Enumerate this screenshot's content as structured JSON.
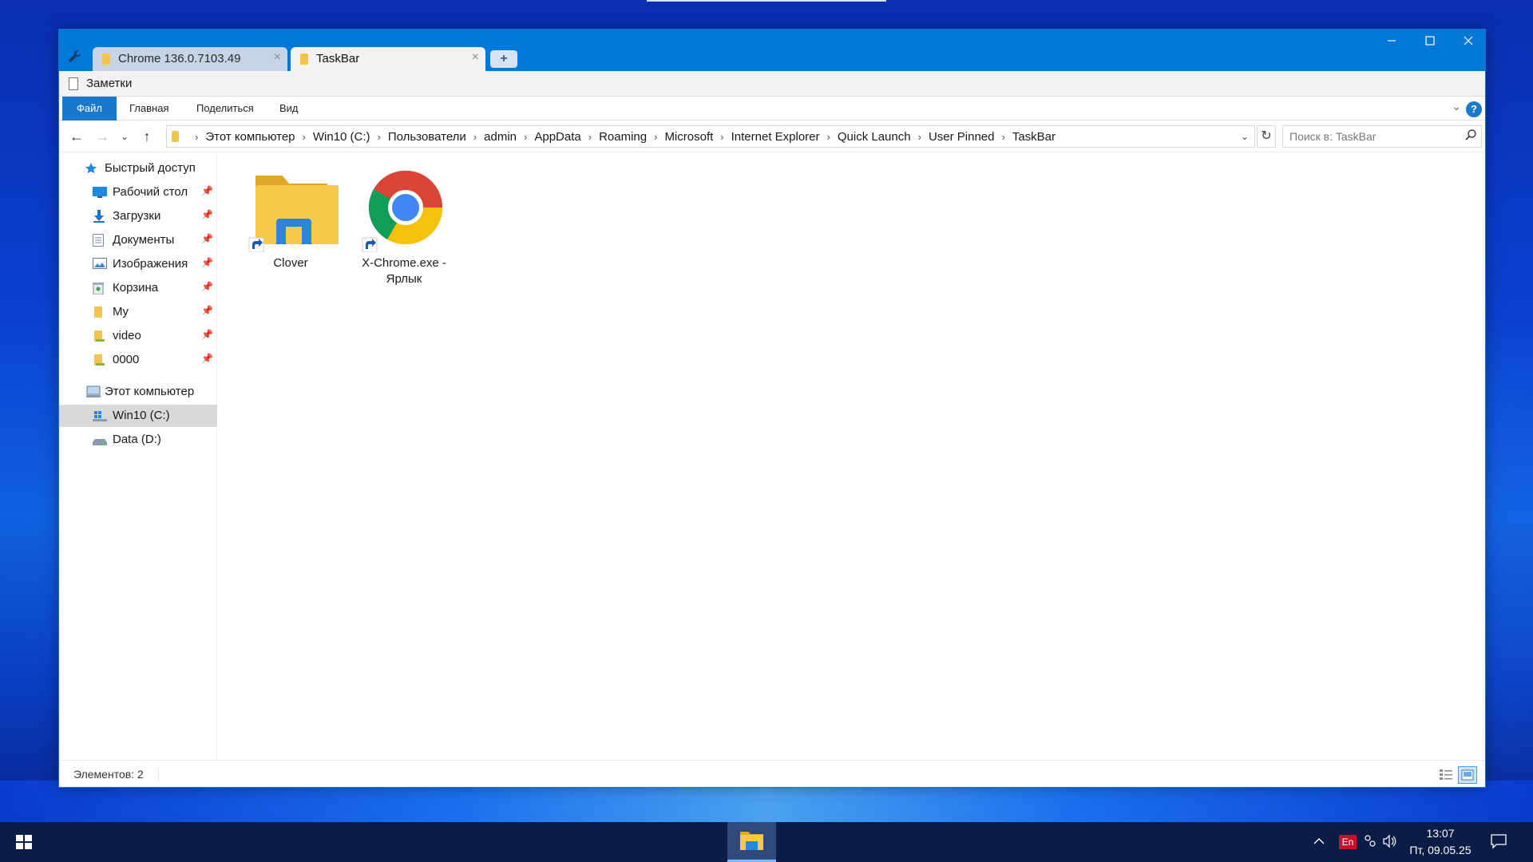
{
  "tabs": [
    {
      "label": "Chrome 136.0.7103.49",
      "active": false
    },
    {
      "label": "TaskBar",
      "active": true
    }
  ],
  "window_controls": {
    "minimize": "—",
    "maximize": "☐",
    "close": "✕"
  },
  "notes": {
    "label": "Заметки"
  },
  "ribbon": {
    "file": "Файл",
    "home": "Главная",
    "share": "Поделиться",
    "view": "Вид",
    "help": "?"
  },
  "breadcrumbs": [
    "Этот компьютер",
    "Win10 (C:)",
    "Пользователи",
    "admin",
    "AppData",
    "Roaming",
    "Microsoft",
    "Internet Explorer",
    "Quick Launch",
    "User Pinned",
    "TaskBar"
  ],
  "search": {
    "placeholder": "Поиск в: TaskBar"
  },
  "sidebar": {
    "quick_access": "Быстрый доступ",
    "pinned": [
      {
        "label": "Рабочий стол",
        "icon": "desktop-icon"
      },
      {
        "label": "Загрузки",
        "icon": "downloads-icon"
      },
      {
        "label": "Документы",
        "icon": "documents-icon"
      },
      {
        "label": "Изображения",
        "icon": "pictures-icon"
      },
      {
        "label": "Корзина",
        "icon": "recycle-bin-icon"
      },
      {
        "label": "My",
        "icon": "folder-icon"
      },
      {
        "label": "video",
        "icon": "folder-icon"
      },
      {
        "label": "0000",
        "icon": "folder-icon"
      }
    ],
    "this_pc": "Этот компьютер",
    "drives": [
      {
        "label": "Win10 (C:)",
        "selected": true
      },
      {
        "label": "Data (D:)",
        "selected": false
      }
    ]
  },
  "files": [
    {
      "name": "Clover",
      "icon": "folder-shortcut-icon"
    },
    {
      "name_line1": "X-Chrome.exe -",
      "name_line2": "Ярлык",
      "icon": "chrome-shortcut-icon"
    }
  ],
  "status": {
    "count": "Элементов: 2"
  },
  "taskbar": {
    "lang": "En",
    "time": "13:07",
    "date": "Пт, 09.05.25"
  },
  "colors": {
    "accent": "#0078d7",
    "taskbar": "#0b1d47"
  }
}
